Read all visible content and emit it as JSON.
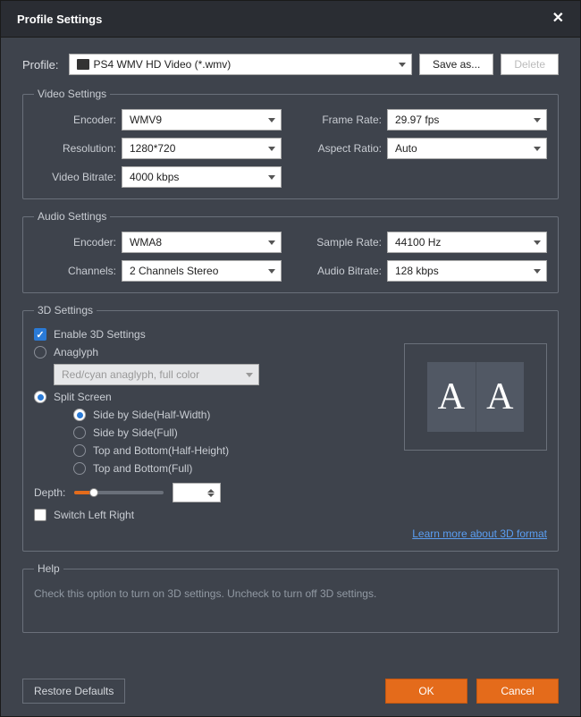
{
  "title": "Profile Settings",
  "profile": {
    "label": "Profile:",
    "value": "PS4 WMV HD Video (*.wmv)",
    "save_as": "Save as...",
    "delete": "Delete"
  },
  "video": {
    "legend": "Video Settings",
    "encoder_label": "Encoder:",
    "encoder": "WMV9",
    "framerate_label": "Frame Rate:",
    "framerate": "29.97 fps",
    "resolution_label": "Resolution:",
    "resolution": "1280*720",
    "aspect_label": "Aspect Ratio:",
    "aspect": "Auto",
    "bitrate_label": "Video Bitrate:",
    "bitrate": "4000 kbps"
  },
  "audio": {
    "legend": "Audio Settings",
    "encoder_label": "Encoder:",
    "encoder": "WMA8",
    "samplerate_label": "Sample Rate:",
    "samplerate": "44100 Hz",
    "channels_label": "Channels:",
    "channels": "2 Channels Stereo",
    "bitrate_label": "Audio Bitrate:",
    "bitrate": "128 kbps"
  },
  "three_d": {
    "legend": "3D Settings",
    "enable": "Enable 3D Settings",
    "anaglyph": "Anaglyph",
    "anaglyph_mode": "Red/cyan anaglyph, full color",
    "split": "Split Screen",
    "sbs_half": "Side by Side(Half-Width)",
    "sbs_full": "Side by Side(Full)",
    "tab_half": "Top and Bottom(Half-Height)",
    "tab_full": "Top and Bottom(Full)",
    "depth_label": "Depth:",
    "depth_value": "",
    "switch_lr": "Switch Left Right",
    "learn_more": "Learn more about 3D format",
    "preview_letter": "A"
  },
  "help": {
    "legend": "Help",
    "text": "Check this option to turn on 3D settings. Uncheck to turn off 3D settings."
  },
  "footer": {
    "restore": "Restore Defaults",
    "ok": "OK",
    "cancel": "Cancel"
  }
}
